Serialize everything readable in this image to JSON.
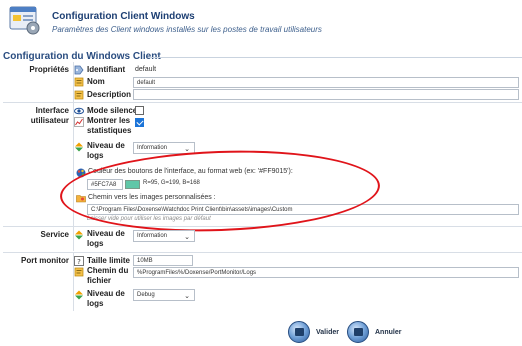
{
  "header": {
    "title": "Configuration Client Windows",
    "subtitle": "Paramètres des Client windows installés sur les postes de travail utilisateurs",
    "icon": "window-config-icon"
  },
  "section": {
    "title": "Configuration du Windows Client"
  },
  "groups": {
    "proprietes": {
      "label": "Propriétés",
      "identifiant_label": "Identifiant",
      "identifiant_value": "default",
      "nom_label": "Nom",
      "nom_value": "default",
      "description_label": "Description",
      "description_value": ""
    },
    "interface": {
      "label_line1": "Interface",
      "label_line2": "utilisateur",
      "mode_silence_label": "Mode silence",
      "mode_silence_checked": false,
      "montrer_label_1": "Montrer les",
      "montrer_label_2": "statistiques",
      "montrer_checked": true,
      "niveau_label_1": "Niveau de",
      "niveau_label_2": "logs",
      "niveau_value": "Information",
      "couleur_label": "Couleur des boutons de l'interface, au format web (ex: '#FF9015'):",
      "couleur_value": "#5FC7A8",
      "couleur_hex": "#5FC7A8",
      "couleur_rgb": "R=95, G=199, B=168",
      "chemin_label": "Chemin vers les images personnalisées :",
      "chemin_value": "C:\\Program Files\\Doxense\\Watchdoc Print Client\\bin\\assets\\images\\Custom",
      "chemin_hint": "Laisser vide pour utiliser les images par défaut"
    },
    "service": {
      "label": "Service",
      "niveau_label_1": "Niveau de",
      "niveau_label_2": "logs",
      "niveau_value": "Information"
    },
    "port_monitor": {
      "label": "Port monitor",
      "taille_label": "Taille limite",
      "taille_value": "10MB",
      "chemin_label_1": "Chemin du",
      "chemin_label_2": "fichier",
      "chemin_value": "%ProgramFiles%/Doxense/PortMonitor/Logs",
      "niveau_label_1": "Niveau de",
      "niveau_label_2": "logs",
      "niveau_value": "Debug"
    }
  },
  "buttons": {
    "valider": "Valider",
    "annuler": "Annuler"
  },
  "colors": {
    "title_blue": "#1d3f73",
    "accent_red": "#e0141a",
    "swatch": "#5FC7A8"
  }
}
